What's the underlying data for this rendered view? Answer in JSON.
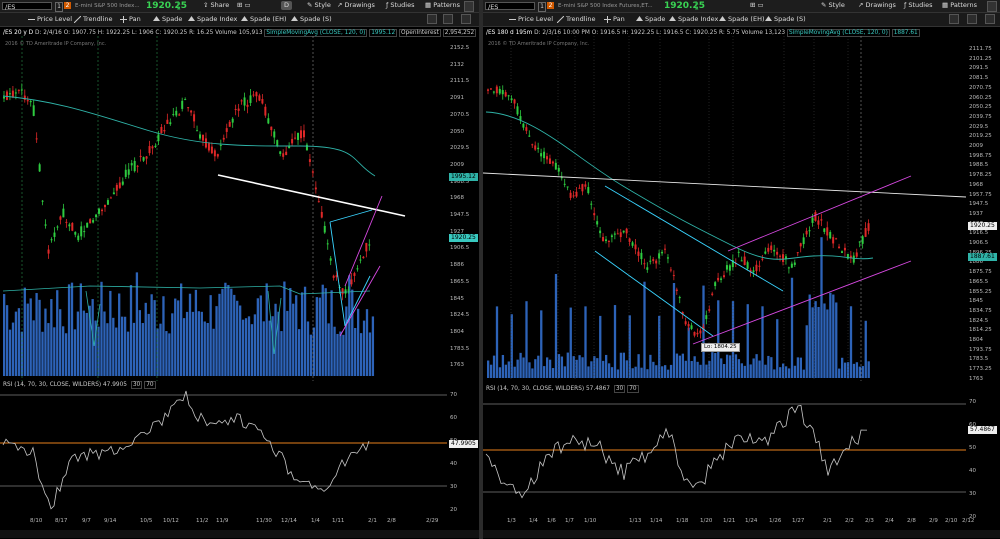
{
  "colors": {
    "up": "#2ecc40",
    "down": "#e02828",
    "volume": "#2d63b8",
    "sma": "#2fb3a8",
    "rsi": "#c8c8c8",
    "rsi_mid": "#e8801c",
    "white_line": "#ffffff",
    "cyan_line": "#39d4ff",
    "magenta_line": "#d648e0"
  },
  "left": {
    "symbol": "/ES",
    "description": "E-mini S&P 500 Index...",
    "price": "1920.25",
    "toolbar": {
      "share": "Share",
      "d_button": "D",
      "style": "Style",
      "drawings": "Drawings",
      "studies": "Studies",
      "patterns": "Patterns"
    },
    "tools": [
      "Price Level",
      "Trendline",
      "Pan",
      "Spade",
      "Spade Index",
      "Spade (EH)",
      "Spade (S)"
    ],
    "header": {
      "instrument": "/ES 20 y D",
      "date": "D: 2/4/16",
      "open": "O: 1907.75",
      "high": "H: 1922.25",
      "low": "L: 1906",
      "close": "C: 1920.25",
      "range": "R: 16.25",
      "volume_label": "Volume",
      "volume_value": "105,913",
      "sma_label": "SimpleMovingAvg (CLOSE, 120, 0)",
      "sma_value": "1995.12",
      "oi_label": "OpenInterest",
      "oi_value": "2,954,252"
    },
    "copyright": "2016 © TD Ameritrade IP Company, Inc.",
    "price_axis": [
      "2152.5",
      "2132",
      "2111.5",
      "2091",
      "2070.5",
      "2050",
      "2029.5",
      "2009",
      "1988.5",
      "1968",
      "1947.5",
      "1927",
      "1906.5",
      "1886",
      "1865.5",
      "1845",
      "1824.5",
      "1804",
      "1783.5",
      "1763"
    ],
    "sma_tag": "1995.12",
    "price_tag": "1920.25",
    "rsi_header": {
      "label": "RSI (14, 70, 30, CLOSE, WILDERS)",
      "value": "47.9905",
      "ob": "30",
      "os": "70"
    },
    "rsi_axis": [
      "70",
      "60",
      "50",
      "40",
      "30",
      "20"
    ],
    "rsi_tag": "47.9905",
    "x_axis": [
      "8/10",
      "8/17",
      "9/7",
      "9/14",
      "10/5",
      "10/12",
      "11/2",
      "11/9",
      "11/30",
      "12/14",
      "1/4",
      "1/11",
      "2/1",
      "2/8",
      "2/29"
    ]
  },
  "right": {
    "symbol": "/ES",
    "description": "E-mini S&P 500 Index Futures,ET...",
    "price": "1920.25",
    "toolbar": {
      "style": "Style",
      "drawings": "Drawings",
      "studies": "Studies",
      "patterns": "Patterns"
    },
    "tools": [
      "Price Level",
      "Trendline",
      "Pan",
      "Spade",
      "Spade Index",
      "Spade (EH)",
      "Spade (S)"
    ],
    "header": {
      "instrument": "/ES 180 d 195m",
      "date": "D: 2/3/16 10:00 PM",
      "open": "O: 1916.5",
      "high": "H: 1922.25",
      "low": "L: 1916.5",
      "close": "C: 1920.25",
      "range": "R: 5.75",
      "volume_label": "Volume",
      "volume_value": "13,123",
      "sma_label": "SimpleMovingAvg (CLOSE, 120, 0)",
      "sma_value": "1887.61"
    },
    "copyright": "2016 © TD Ameritrade IP Company, Inc.",
    "price_axis": [
      "2111.75",
      "2101.25",
      "2091.5",
      "2081.5",
      "2070.75",
      "2060.25",
      "2050.25",
      "2039.75",
      "2029.5",
      "2019.25",
      "2009",
      "1998.75",
      "1988.5",
      "1978.25",
      "1968",
      "1957.75",
      "1947.5",
      "1937",
      "1927",
      "1916.5",
      "1906.5",
      "1896.25",
      "1886",
      "1875.75",
      "1865.5",
      "1855.25",
      "1845",
      "1834.75",
      "1824.5",
      "1814.25",
      "1804",
      "1793.75",
      "1783.5",
      "1773.25",
      "1763"
    ],
    "sma_tag": "1887.61",
    "price_tag": "1920.25",
    "low_label": "Lo: 1804.25",
    "rsi_header": {
      "label": "RSI (14, 70, 30, CLOSE, WILDERS)",
      "value": "57.4867",
      "ob": "30",
      "os": "70"
    },
    "rsi_axis": [
      "70",
      "60",
      "50",
      "40",
      "30",
      "20"
    ],
    "rsi_tag": "57.4867",
    "x_axis": [
      "1/3",
      "1/4",
      "1/6",
      "1/7",
      "1/10",
      "1/13",
      "1/14",
      "1/18",
      "1/20",
      "1/21",
      "1/24",
      "1/26",
      "1/27",
      "2/1",
      "2/2",
      "2/3",
      "2/4",
      "2/8",
      "2/9",
      "2/10",
      "2/12"
    ]
  }
}
